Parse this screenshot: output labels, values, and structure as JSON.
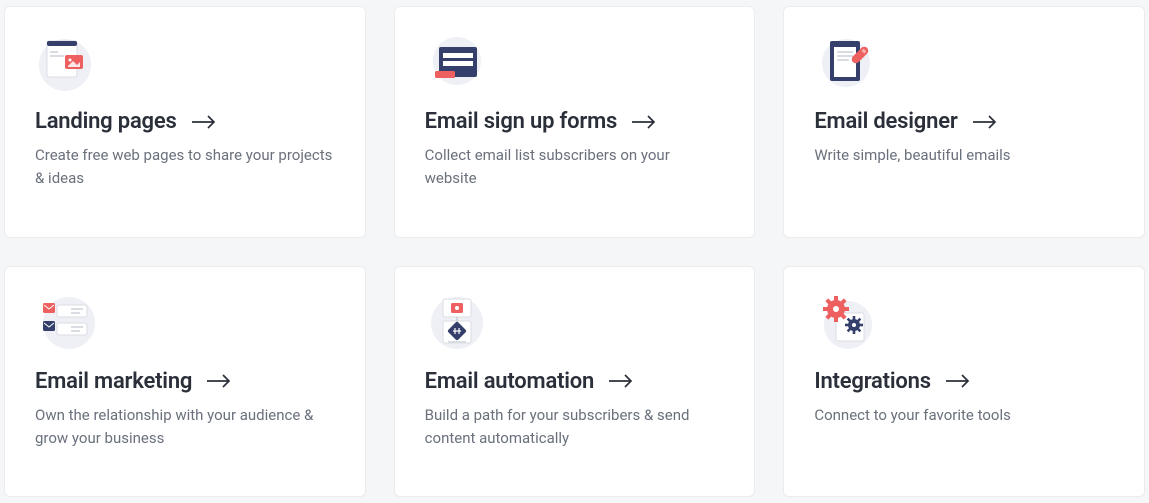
{
  "colors": {
    "navy": "#34406b",
    "accent": "#ee5f60",
    "blob": "#eef0f5",
    "text_dark": "#2a2f3a",
    "text_muted": "#6a707c"
  },
  "cards": [
    {
      "key": "landing-pages",
      "icon": "landing-pages-icon",
      "title": "Landing pages",
      "desc": "Create free web pages to share your projects & ideas"
    },
    {
      "key": "email-signup-forms",
      "icon": "signup-forms-icon",
      "title": "Email sign up forms",
      "desc": "Collect email list subscribers on your website"
    },
    {
      "key": "email-designer",
      "icon": "email-designer-icon",
      "title": "Email designer",
      "desc": "Write simple, beautiful emails"
    },
    {
      "key": "email-marketing",
      "icon": "email-marketing-icon",
      "title": "Email marketing",
      "desc": "Own the relationship with your audience & grow your business"
    },
    {
      "key": "email-automation",
      "icon": "email-automation-icon",
      "title": "Email automation",
      "desc": "Build a path for your subscribers & send content automatically"
    },
    {
      "key": "integrations",
      "icon": "integrations-icon",
      "title": "Integrations",
      "desc": "Connect to your favorite tools"
    }
  ]
}
